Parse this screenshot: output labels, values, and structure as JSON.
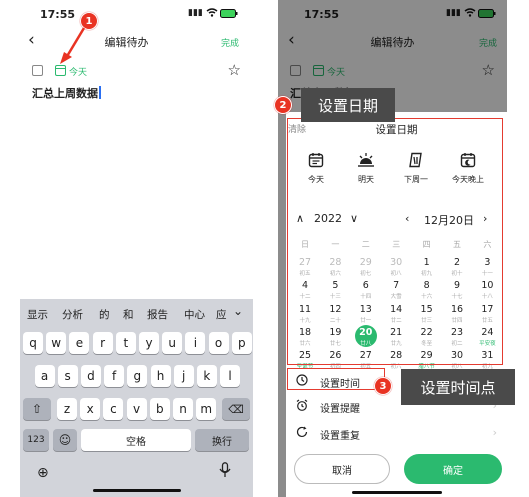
{
  "status": {
    "time": "17:55"
  },
  "editor": {
    "back": "‹",
    "title": "编辑待办",
    "done": "完成",
    "today_label": "今天",
    "task_text": "汇总上周数据"
  },
  "keyboard": {
    "candidates": [
      "显示",
      "分析",
      "的",
      "和",
      "报告",
      "中心",
      "应"
    ],
    "row1": [
      "q",
      "w",
      "e",
      "r",
      "t",
      "y",
      "u",
      "i",
      "o",
      "p"
    ],
    "row2": [
      "a",
      "s",
      "d",
      "f",
      "g",
      "h",
      "j",
      "k",
      "l"
    ],
    "row3": [
      "z",
      "x",
      "c",
      "v",
      "b",
      "n",
      "m"
    ],
    "num_key": "123",
    "space": "空格",
    "return": "换行"
  },
  "date_sheet": {
    "clear": "清除",
    "title": "设置日期",
    "quick": [
      {
        "label": "今天",
        "icon": "calendar-today-icon"
      },
      {
        "label": "明天",
        "icon": "sunrise-icon"
      },
      {
        "label": "下周一",
        "icon": "calendar-page-icon"
      },
      {
        "label": "今天晚上",
        "icon": "calendar-moon-icon"
      }
    ],
    "year": "2022",
    "month": "12月20日",
    "weekdays": [
      "日",
      "一",
      "二",
      "三",
      "四",
      "五",
      "六"
    ],
    "weeks": [
      [
        {
          "n": "27",
          "s": "初五",
          "g": true
        },
        {
          "n": "28",
          "s": "初六",
          "g": true
        },
        {
          "n": "29",
          "s": "初七",
          "g": true
        },
        {
          "n": "30",
          "s": "初八",
          "g": true
        },
        {
          "n": "1",
          "s": "初九"
        },
        {
          "n": "2",
          "s": "初十"
        },
        {
          "n": "3",
          "s": "十一"
        }
      ],
      [
        {
          "n": "4",
          "s": "十二"
        },
        {
          "n": "5",
          "s": "十三"
        },
        {
          "n": "6",
          "s": "十四"
        },
        {
          "n": "7",
          "s": "大雪"
        },
        {
          "n": "8",
          "s": "十六"
        },
        {
          "n": "9",
          "s": "十七"
        },
        {
          "n": "10",
          "s": "十八"
        }
      ],
      [
        {
          "n": "11",
          "s": "十九"
        },
        {
          "n": "12",
          "s": "二十"
        },
        {
          "n": "13",
          "s": "廿一"
        },
        {
          "n": "14",
          "s": "廿二"
        },
        {
          "n": "15",
          "s": "廿三"
        },
        {
          "n": "16",
          "s": "廿四"
        },
        {
          "n": "17",
          "s": "廿五"
        }
      ],
      [
        {
          "n": "18",
          "s": "廿六"
        },
        {
          "n": "19",
          "s": "廿七"
        },
        {
          "n": "20",
          "s": "廿八",
          "sel": true
        },
        {
          "n": "21",
          "s": "廿九"
        },
        {
          "n": "22",
          "s": "冬至"
        },
        {
          "n": "23",
          "s": "初二"
        },
        {
          "n": "24",
          "s": "平安夜",
          "h": true
        }
      ],
      [
        {
          "n": "25",
          "s": "圣诞节",
          "h": true
        },
        {
          "n": "26",
          "s": "初四"
        },
        {
          "n": "27",
          "s": "初五"
        },
        {
          "n": "28",
          "s": "初六"
        },
        {
          "n": "29",
          "s": "腊八节",
          "h": true
        },
        {
          "n": "30",
          "s": "初八"
        },
        {
          "n": "31",
          "s": "初九"
        }
      ]
    ],
    "options": [
      "设置时间",
      "设置提醒",
      "设置重复"
    ],
    "cancel": "取消",
    "confirm": "确定"
  },
  "annotations": {
    "num1": "1",
    "num2": "2",
    "num3": "3",
    "label2": "设置日期",
    "label3": "设置时间点"
  },
  "colors": {
    "accent": "#2bba6f",
    "callout_red": "#e93323",
    "callout_bg": "#4a4a4a"
  }
}
